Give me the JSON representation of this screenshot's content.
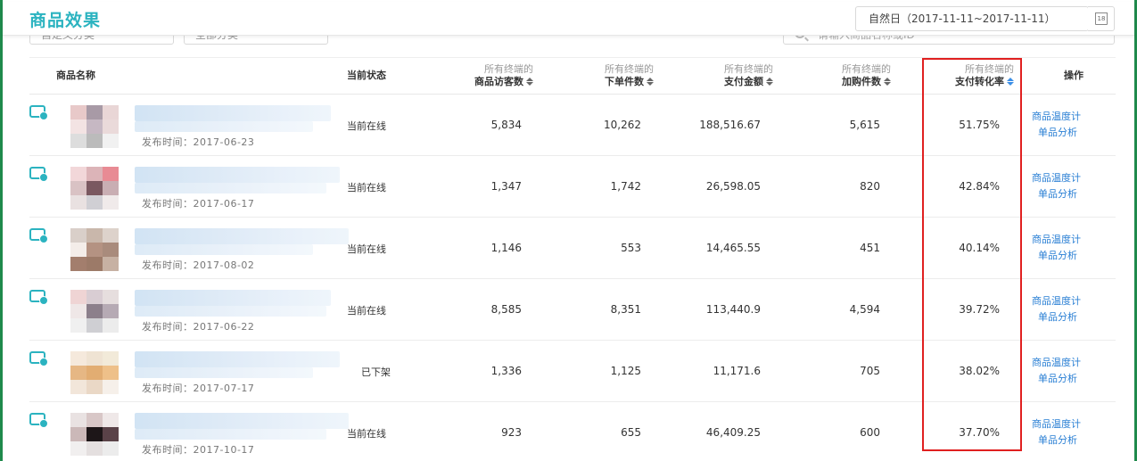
{
  "header": {
    "title": "商品效果",
    "date_range": "自然日（2017-11-11~2017-11-11）",
    "calendar_day": "18"
  },
  "filters": {
    "custom_category": "自定义分类",
    "all_category": "全部分类",
    "search_placeholder": "请输入商品名称或ID"
  },
  "table": {
    "columns": [
      {
        "sub": "",
        "main": "商品名称"
      },
      {
        "sub": "",
        "main": "当前状态"
      },
      {
        "sub": "所有终端的",
        "main": "商品访客数"
      },
      {
        "sub": "所有终端的",
        "main": "下单件数"
      },
      {
        "sub": "所有终端的",
        "main": "支付金额"
      },
      {
        "sub": "所有终端的",
        "main": "加购件数"
      },
      {
        "sub": "所有终端的",
        "main": "支付转化率"
      },
      {
        "sub": "",
        "main": "操作"
      }
    ],
    "rows": [
      {
        "pub_date": "发布时间：2017-06-23",
        "status": "当前在线",
        "visitors": "5,834",
        "orders": "10,262",
        "payment": "188,516.67",
        "cart": "5,615",
        "conversion": "51.75%"
      },
      {
        "pub_date": "发布时间：2017-06-17",
        "status": "当前在线",
        "visitors": "1,347",
        "orders": "1,742",
        "payment": "26,598.05",
        "cart": "820",
        "conversion": "42.84%"
      },
      {
        "pub_date": "发布时间：2017-08-02",
        "status": "当前在线",
        "visitors": "1,146",
        "orders": "553",
        "payment": "14,465.55",
        "cart": "451",
        "conversion": "40.14%"
      },
      {
        "pub_date": "发布时间：2017-06-22",
        "status": "当前在线",
        "visitors": "8,585",
        "orders": "8,351",
        "payment": "113,440.9",
        "cart": "4,594",
        "conversion": "39.72%"
      },
      {
        "pub_date": "发布时间：2017-07-17",
        "status": "已下架",
        "visitors": "1,336",
        "orders": "1,125",
        "payment": "11,171.6",
        "cart": "705",
        "conversion": "38.02%"
      },
      {
        "pub_date": "发布时间：2017-10-17",
        "status": "当前在线",
        "visitors": "923",
        "orders": "655",
        "payment": "46,409.25",
        "cart": "600",
        "conversion": "37.70%"
      }
    ],
    "actions": {
      "temperature": "商品温度计",
      "analysis": "单品分析"
    }
  },
  "colors": {
    "accent": "#2bb3c0",
    "link": "#2a7fd4",
    "highlight": "#e02020"
  }
}
